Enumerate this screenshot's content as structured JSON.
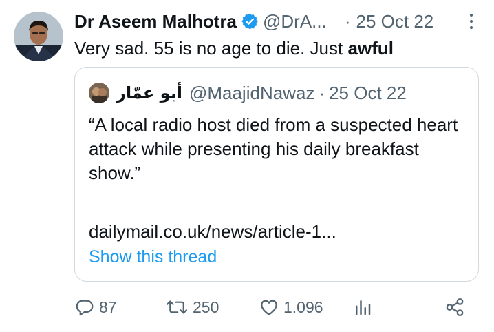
{
  "tweet": {
    "author_name": "Dr Aseem Malhotra",
    "author_handle": "@DrA...",
    "date": "25 Oct 22",
    "text_prefix": "Very sad. 55 is no age to die. Just ",
    "text_bold": "awful",
    "verified": true
  },
  "quote": {
    "author_name": "أبو عمّار",
    "author_handle": "@MaajidNawaz",
    "date": "25 Oct 22",
    "text": "“A local radio host died from a suspected heart attack while presenting his daily breakfast show.”",
    "link_text": "dailymail.co.uk/news/article-1...",
    "show_thread_label": "Show this thread"
  },
  "actions": {
    "reply_count": "87",
    "retweet_count": "250",
    "like_count": "1.096"
  },
  "colors": {
    "accent": "#1d9bf0",
    "text": "#0f1419",
    "secondary": "#536471",
    "border": "#cfd9de"
  },
  "icons": {
    "verified": "verified-badge-icon",
    "more": "more-vertical-icon",
    "reply": "reply-icon",
    "retweet": "retweet-icon",
    "like": "heart-icon",
    "views": "views-icon",
    "share": "share-icon"
  }
}
